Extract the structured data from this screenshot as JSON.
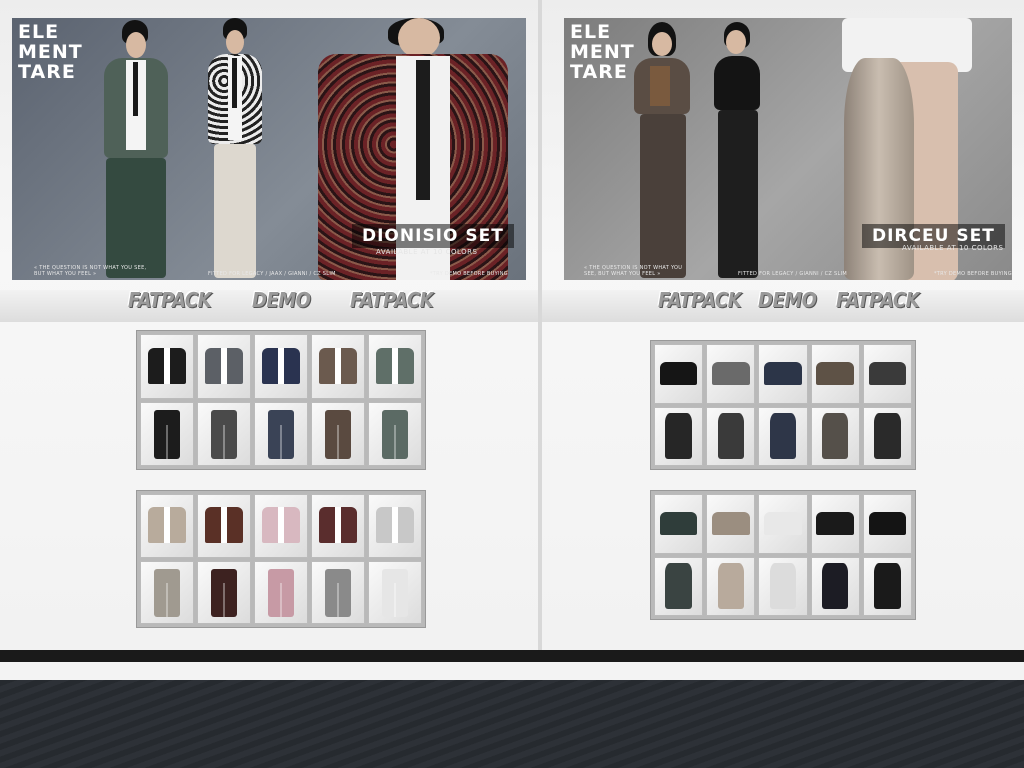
{
  "left_panel": {
    "logo": [
      "ELE",
      "MENT",
      "TARE"
    ],
    "set_title": "DIONISIO SET",
    "set_subtitle": "AVAILABLE AT 10 COLORS",
    "footer_left": "« THE QUESTION IS NOT WHAT YOU SEE, BUT WHAT YOU FEEL »",
    "footer_mid": "FITTED FOR LEGACY / JAAX / GIANNI / CZ SLIM",
    "footer_right": "*TRY DEMO BEFORE BUYING",
    "links": [
      "FATPACK",
      "DEMO",
      "FATPACK"
    ],
    "swatches_a_tops": [
      "#1c1c1c",
      "#5c6066",
      "#2a3350",
      "#6b5a4e",
      "#5f6f68"
    ],
    "swatches_a_bottoms": [
      "#1c1c1c",
      "#4a4a4a",
      "#3a4356",
      "#5a4a40",
      "#5b6a64"
    ],
    "swatches_b_tops": [
      "#b8ab9c",
      "#5a3026",
      "#d8b8c0",
      "#5a2d2d",
      "#c8c8c8"
    ],
    "swatches_b_bottoms": [
      "#a09a90",
      "#3d2220",
      "#c79aa5",
      "#8a8a8a",
      "#e6e6e6"
    ]
  },
  "right_panel": {
    "logo": [
      "ELE",
      "MENT",
      "TARE"
    ],
    "set_title": "DIRCEU SET",
    "set_subtitle": "AVAILABLE AT 10 COLORS",
    "footer_left": "« THE QUESTION IS NOT WHAT YOU SEE, BUT WHAT YOU FEEL »",
    "footer_mid": "FITTED FOR LEGACY / GIANNI / CZ SLIM",
    "footer_right": "*TRY DEMO BEFORE BUYING",
    "links": [
      "FATPACK",
      "DEMO",
      "FATPACK"
    ],
    "swatches_a_tops": [
      "#151515",
      "#6a6a6a",
      "#2c3548",
      "#5e5246",
      "#3a3a3a"
    ],
    "swatches_a_bottoms": [
      "#262626",
      "#3a3a3a",
      "#2e3648",
      "#55504a",
      "#2a2a2a"
    ],
    "swatches_b_tops": [
      "#2f3d3a",
      "#9b8e80",
      "#e8e8e8",
      "#1a1a1a",
      "#141414"
    ],
    "swatches_b_bottoms": [
      "#3a4442",
      "#b8aa9c",
      "#dcdcdc",
      "#1c1c24",
      "#1a1a1a"
    ]
  },
  "colors": {
    "banner_left": "#6f7781",
    "banner_right": "#9a9a9a",
    "link_text": "#9a9a9a"
  }
}
